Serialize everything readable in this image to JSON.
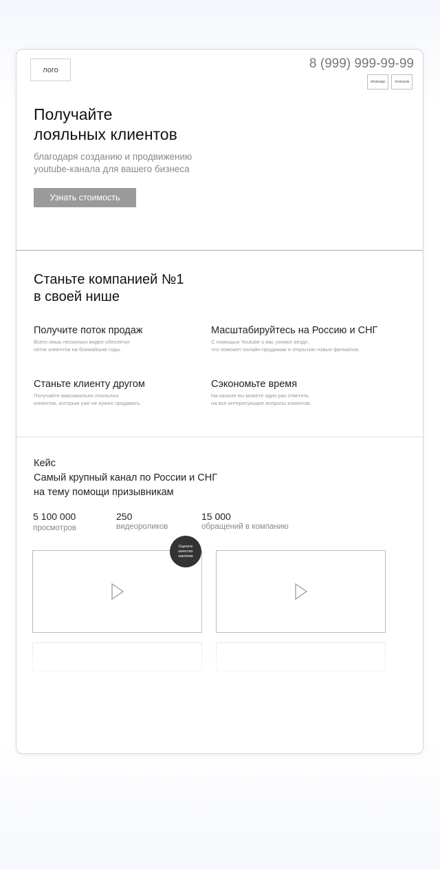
{
  "header": {
    "logo_label": "лого",
    "phone": "8 (999) 999-99-99",
    "messengers": [
      "whatsapp",
      "телеграм"
    ]
  },
  "hero": {
    "title_line1": "Получайте",
    "title_line2": "лояльных клиентов",
    "subtitle_line1": "благодаря созданию и продвижению",
    "subtitle_line2": "youtube-канала для вашего бизнеса",
    "cta_label": "Узнать стоимость"
  },
  "benefits": {
    "title_line1": "Станьте компанией №1",
    "title_line2": "в своей нише",
    "items": [
      {
        "title": "Получите поток продаж",
        "desc_line1": "Всего лишь несколько видео обеспечат",
        "desc_line2": "поток клиентов на ближайшие годы."
      },
      {
        "title": "Масштабируйтесь на Россию и СНГ",
        "desc_line1": "С помощью Youtube о вас узнают везде,",
        "desc_line2": "что поможет онлайн-продажам и открытию новых филиалов."
      },
      {
        "title": "Станьте клиенту другом",
        "desc_line1": "Получайте максимально лояльных",
        "desc_line2": "клиентов, которым уже не нужно продавать."
      },
      {
        "title": "Сэкономьте время",
        "desc_line1": "На канале вы можете один раз ответить",
        "desc_line2": "на все интересующие вопросы клиентов."
      }
    ]
  },
  "case": {
    "label": "Кейс",
    "title_line1": "Самый крупный канал по России и СНГ",
    "title_line2": "на тему помощи призывникам",
    "stats": [
      {
        "value": "5 100 000",
        "label": "просмотров"
      },
      {
        "value": "250",
        "label": "видеороликов"
      },
      {
        "value": "15 000",
        "label": "обращений в компанию"
      }
    ],
    "badge_line1": "Оцените",
    "badge_line2": "качество",
    "badge_line3": "картинки"
  }
}
